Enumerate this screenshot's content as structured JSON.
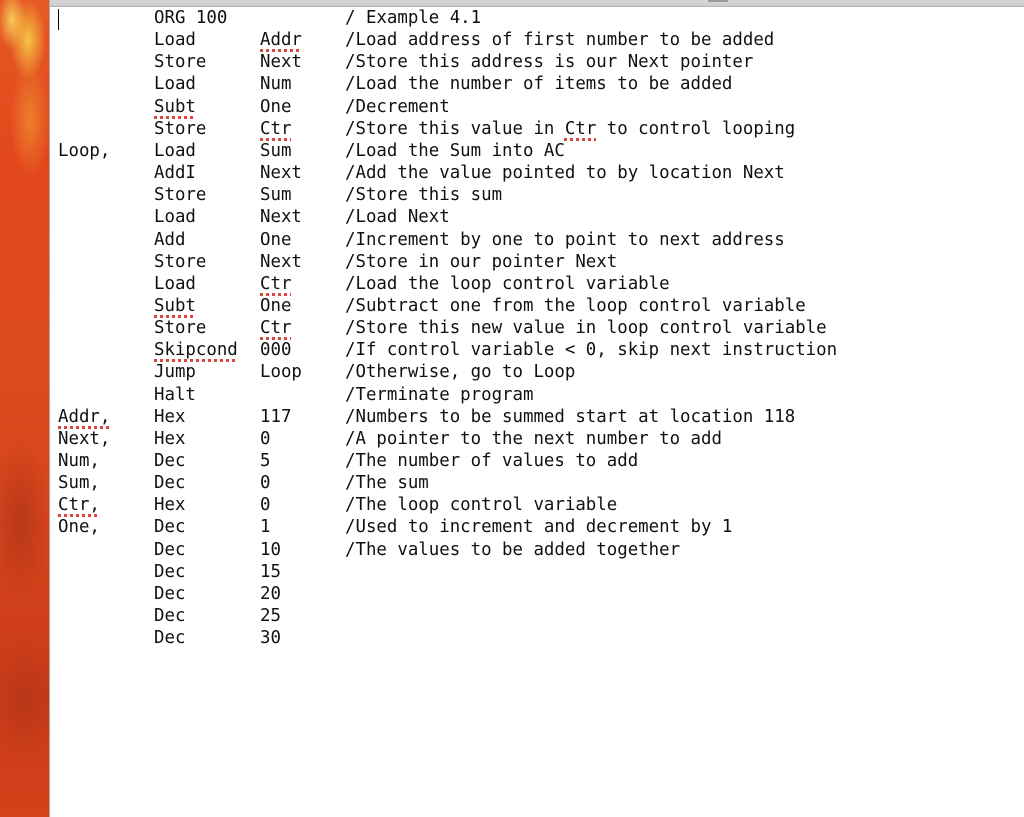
{
  "window": {
    "kind": "text-editor",
    "caret_visible": true
  },
  "lines": [
    {
      "label": "",
      "op": "ORG 100",
      "arg": "",
      "comment": "/ Example 4.1",
      "spell": []
    },
    {
      "label": "",
      "op": "Load",
      "arg": "Addr",
      "comment": "/Load address of first number to be added",
      "spell": [
        "arg"
      ]
    },
    {
      "label": "",
      "op": "Store",
      "arg": "Next",
      "comment": "/Store this address is our Next pointer",
      "spell": []
    },
    {
      "label": "",
      "op": "Load",
      "arg": "Num",
      "comment": "/Load the number of items to be added",
      "spell": []
    },
    {
      "label": "",
      "op": "Subt",
      "arg": "One",
      "comment": "/Decrement",
      "spell": [
        "op"
      ]
    },
    {
      "label": "",
      "op": "Store",
      "arg": "Ctr",
      "comment_parts": [
        "/Store this value in ",
        "Ctr",
        " to control looping"
      ],
      "comment": "/Store this value in Ctr to control looping",
      "spell": [
        "arg",
        "comment_word"
      ]
    },
    {
      "label": "Loop,",
      "op": "Load",
      "arg": "Sum",
      "comment": "/Load the Sum into AC",
      "spell": []
    },
    {
      "label": "",
      "op": "AddI",
      "arg": "Next",
      "comment": "/Add the value pointed to by location Next",
      "spell": []
    },
    {
      "label": "",
      "op": "Store",
      "arg": "Sum",
      "comment": "/Store this sum",
      "spell": []
    },
    {
      "label": "",
      "op": "Load",
      "arg": "Next",
      "comment": "/Load Next",
      "spell": []
    },
    {
      "label": "",
      "op": "Add",
      "arg": "One",
      "comment": "/Increment by one to point to next address",
      "spell": []
    },
    {
      "label": "",
      "op": "Store",
      "arg": "Next",
      "comment": "/Store in our pointer Next",
      "spell": []
    },
    {
      "label": "",
      "op": "Load",
      "arg": "Ctr",
      "comment": "/Load the loop control variable",
      "spell": [
        "arg"
      ]
    },
    {
      "label": "",
      "op": "Subt",
      "arg": "One",
      "comment": "/Subtract one from the loop control variable",
      "spell": [
        "op"
      ]
    },
    {
      "label": "",
      "op": "Store",
      "arg": "Ctr",
      "comment": "/Store this new value in loop control variable",
      "spell": [
        "arg"
      ]
    },
    {
      "label": "",
      "op": "Skipcond",
      "arg": "000",
      "comment": "/If control variable < 0, skip next instruction",
      "spell": [
        "op"
      ]
    },
    {
      "label": "",
      "op": "Jump",
      "arg": "Loop",
      "comment": "/Otherwise, go to Loop",
      "spell": []
    },
    {
      "label": "",
      "op": "Halt",
      "arg": "",
      "comment": "/Terminate program",
      "spell": []
    },
    {
      "label": "Addr,",
      "op": "Hex",
      "arg": "117",
      "comment": "/Numbers to be summed start at location 118",
      "spell": [
        "label"
      ]
    },
    {
      "label": "Next,",
      "op": "Hex",
      "arg": "0",
      "comment": "/A pointer to the next number to add",
      "spell": []
    },
    {
      "label": "Num,",
      "op": "Dec",
      "arg": "5",
      "comment": "/The number of values to add",
      "spell": []
    },
    {
      "label": "Sum,",
      "op": "Dec",
      "arg": "0",
      "comment": "/The sum",
      "spell": []
    },
    {
      "label": "Ctr,",
      "op": "Hex",
      "arg": "0",
      "comment": "/The loop control variable",
      "spell": [
        "label"
      ]
    },
    {
      "label": "One,",
      "op": "Dec",
      "arg": "1",
      "comment": "/Used to increment and decrement by 1",
      "spell": []
    },
    {
      "label": "",
      "op": "Dec",
      "arg": "10",
      "comment": "/The values to be added together",
      "spell": []
    },
    {
      "label": "",
      "op": "Dec",
      "arg": "15",
      "comment": "",
      "spell": []
    },
    {
      "label": "",
      "op": "Dec",
      "arg": "20",
      "comment": "",
      "spell": []
    },
    {
      "label": "",
      "op": "Dec",
      "arg": "25",
      "comment": "",
      "spell": []
    },
    {
      "label": "",
      "op": "Dec",
      "arg": "30",
      "comment": "",
      "spell": []
    }
  ],
  "colors": {
    "text": "#111111",
    "spellcheck_underline": "#e2433c",
    "desktop_accent": "#dc4a1e"
  }
}
